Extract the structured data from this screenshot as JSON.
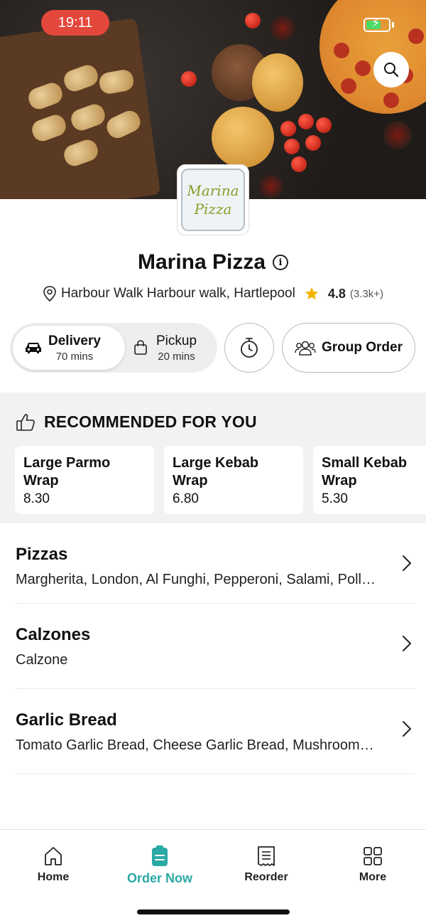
{
  "status_bar": {
    "time": "19:11"
  },
  "restaurant": {
    "logo_line1": "Marina",
    "logo_line2": "Pizza",
    "name": "Marina Pizza",
    "address": "Harbour Walk Harbour walk, Hartlepool",
    "rating": "4.8",
    "rating_count": "(3.3k+)"
  },
  "order_modes": {
    "delivery": {
      "label": "Delivery",
      "time": "70 mins"
    },
    "pickup": {
      "label": "Pickup",
      "time": "20 mins"
    },
    "group_order_label": "Group Order"
  },
  "recommended": {
    "title": "RECOMMENDED FOR YOU",
    "items": [
      {
        "name_line1": "Large Parmo",
        "name_line2": "Wrap",
        "price": "8.30"
      },
      {
        "name_line1": "Large Kebab",
        "name_line2": "Wrap",
        "price": "6.80"
      },
      {
        "name_line1": "Small Kebab",
        "name_line2": "Wrap",
        "price": "5.30"
      }
    ]
  },
  "categories": [
    {
      "name": "Pizzas",
      "description": "Margherita, London, Al Funghi, Pepperoni, Salami, Poll…"
    },
    {
      "name": "Calzones",
      "description": "Calzone"
    },
    {
      "name": "Garlic Bread",
      "description": "Tomato Garlic Bread, Cheese Garlic Bread, Mushroom…"
    }
  ],
  "bottom_nav": [
    {
      "label": "Home",
      "icon": "home-icon"
    },
    {
      "label": "Order Now",
      "icon": "order-icon",
      "active": true
    },
    {
      "label": "Reorder",
      "icon": "receipt-icon"
    },
    {
      "label": "More",
      "icon": "grid-icon"
    }
  ],
  "colors": {
    "accent": "#2aa9a4",
    "time_pill": "#e4473c",
    "star": "#f5b400",
    "battery": "#4cd964"
  }
}
